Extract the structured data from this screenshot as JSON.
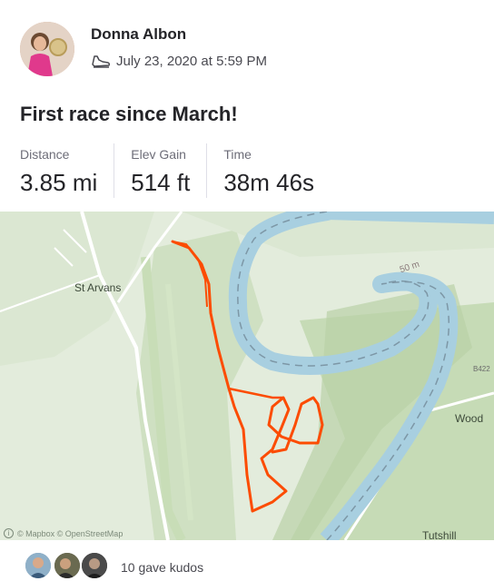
{
  "athlete": {
    "name": "Donna Albon",
    "date": "July 23, 2020 at 5:59 PM",
    "activity_icon": "running-shoe-icon"
  },
  "activity": {
    "title": "First race since March!"
  },
  "stats": [
    {
      "label": "Distance",
      "value": "3.85 mi"
    },
    {
      "label": "Elev Gain",
      "value": "514 ft"
    },
    {
      "label": "Time",
      "value": "38m 46s"
    }
  ],
  "map": {
    "labels": {
      "st_arvans": "St Arvans",
      "woodcroft": "Wood",
      "tutshill": "Tutshill",
      "road": "B422",
      "contour": "50 m"
    },
    "attribution": "© Mapbox © OpenStreetMap",
    "route_color": "#fc4c02",
    "river_color": "#a8cfe0"
  },
  "kudos": {
    "text": "10 gave kudos"
  }
}
